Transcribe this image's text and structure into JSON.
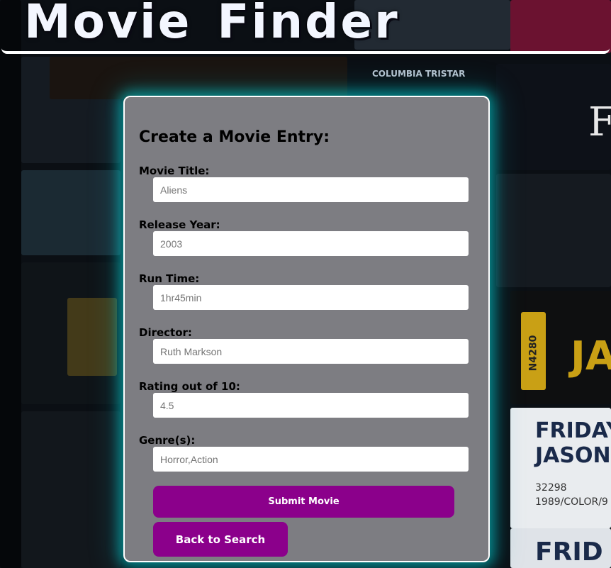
{
  "header": {
    "title": "Movie Finder"
  },
  "form": {
    "title": "Create a Movie Entry:",
    "fields": [
      {
        "label": "Movie Title:",
        "placeholder": "Aliens"
      },
      {
        "label": "Release Year:",
        "placeholder": "2003"
      },
      {
        "label": "Run Time:",
        "placeholder": "1hr45min"
      },
      {
        "label": "Director:",
        "placeholder": "Ruth Markson"
      },
      {
        "label": "Rating out of 10:",
        "placeholder": "4.5"
      },
      {
        "label": "Genre(s):",
        "placeholder": "Horror,Action"
      }
    ],
    "submit_label": "Submit Movie",
    "back_label": "Back to Search"
  },
  "background": {
    "tape_text": [
      "COLUMBIA TRISTAR",
      "FRIDAY",
      "JASON",
      "32298",
      "1989/COLOR/9",
      "FRID",
      "N4280",
      "JA",
      "F"
    ]
  },
  "colors": {
    "accent": "#8b008b",
    "card_glow": "#00ffff",
    "card_bg": "#96969b"
  }
}
